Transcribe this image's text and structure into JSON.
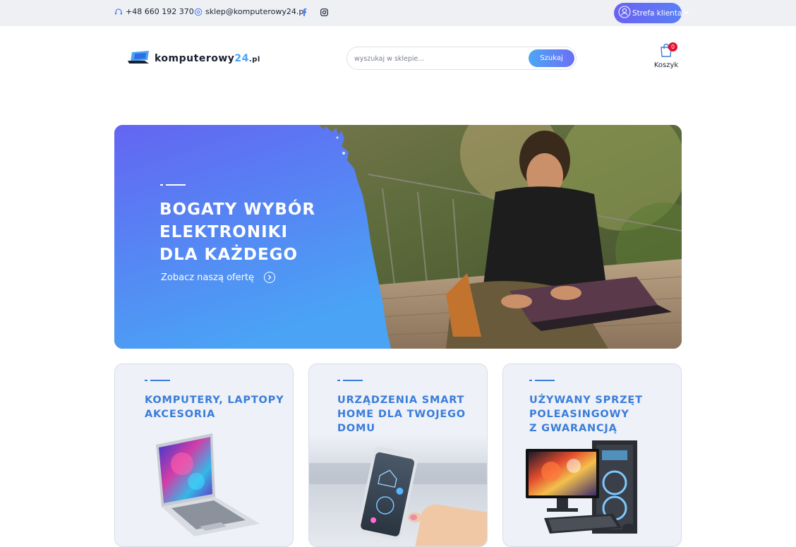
{
  "topbar": {
    "phone": "+48 660 192 370",
    "email": "sklep@komputerowy24.pl",
    "account_label": "Strefa klienta"
  },
  "header": {
    "logo": {
      "main": "komputerowy",
      "num": "24",
      "suffix": ".pl"
    },
    "search": {
      "placeholder": "wyszukaj w sklepie...",
      "button_label": "Szukaj"
    },
    "cart": {
      "label": "Koszyk",
      "count": "0"
    }
  },
  "hero": {
    "title_lines": [
      "BOGATY WYBÓR",
      "ELEKTRONIKI",
      "DLA KAŻDEGO"
    ],
    "link_label": "Zobacz naszą ofertę"
  },
  "categories": [
    {
      "title_lines": [
        "KOMPUTERY, LAPTOPY",
        "AKCESORIA"
      ]
    },
    {
      "title_lines": [
        "URZĄDZENIA SMART",
        "HOME DLA TWOJEGO",
        "DOMU"
      ]
    },
    {
      "title_lines": [
        "UŻYWANY SPRZĘT",
        "POLEASINGOWY",
        "Z GWARANCJĄ"
      ]
    }
  ],
  "colors": {
    "accent": "#3a7ddb",
    "button_gradient_start": "#4ea6f6",
    "button_gradient_end": "#6b6ff3",
    "badge": "#e5102a",
    "topbar_bg": "#eef0f4"
  },
  "icons": [
    "headset-icon",
    "at-icon",
    "facebook-icon",
    "instagram-icon",
    "user-icon",
    "chevron-down-icon",
    "shopping-bag-icon",
    "arrow-right-circle-icon"
  ]
}
